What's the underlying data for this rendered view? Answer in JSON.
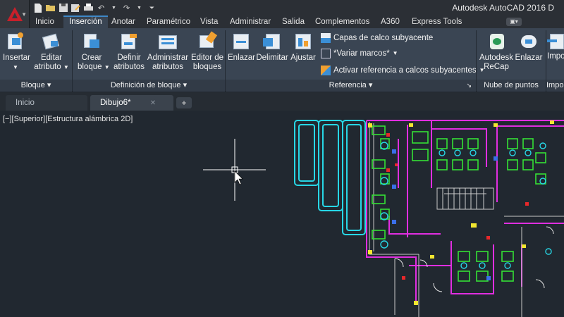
{
  "app": {
    "title": "Autodesk AutoCAD 2016   D"
  },
  "quick_access": [
    "new-icon",
    "open-icon",
    "save-icon",
    "saveas-icon",
    "print-icon",
    "undo-icon",
    "redo-icon",
    "dropdown-icon"
  ],
  "ribbon_tabs": [
    {
      "label": "Inicio"
    },
    {
      "label": "Inserción"
    },
    {
      "label": "Anotar"
    },
    {
      "label": "Paramétrico"
    },
    {
      "label": "Vista"
    },
    {
      "label": "Administrar"
    },
    {
      "label": "Salida"
    },
    {
      "label": "Complementos"
    },
    {
      "label": "A360"
    },
    {
      "label": "Express Tools"
    }
  ],
  "ribbon": {
    "bloque": {
      "title": "Bloque ▾",
      "insertar": "Insertar",
      "editar_atributo_l1": "Editar",
      "editar_atributo_l2": "atributo"
    },
    "definicion": {
      "title": "Definición de bloque ▾",
      "crear_l1": "Crear",
      "crear_l2": "bloque",
      "definir_l1": "Definir",
      "definir_l2": "atributos",
      "admin_l1": "Administrar",
      "admin_l2": "atributos",
      "editor_l1": "Editor de",
      "editor_l2": "bloques"
    },
    "referencia": {
      "title": "Referencia ▾",
      "enlazar": "Enlazar",
      "delimitar": "Delimitar",
      "ajustar": "Ajustar",
      "capas_calco": "Capas de calco subyacente",
      "variar_marcos": "*Variar marcos*",
      "activar_ref": "Activar referencia a calcos subyacentes"
    },
    "nube": {
      "title": "Nube de puntos",
      "recap_l1": "Autodesk",
      "recap_l2": "ReCap",
      "enlazar": "Enlazar"
    },
    "import": {
      "title": "Impo",
      "btn": "Impo"
    }
  },
  "file_tabs": [
    {
      "label": "Inicio"
    },
    {
      "label": "Dibujo6*"
    }
  ],
  "viewport": {
    "label": "[−][Superior][Estructura alámbrica 2D]"
  },
  "colors": {
    "background": "#212830",
    "ribbon": "#3a4553",
    "cyan": "#27d7e6",
    "magenta": "#e02ee0",
    "green": "#35e035",
    "yellow": "#f2e630",
    "red": "#e8282a"
  }
}
